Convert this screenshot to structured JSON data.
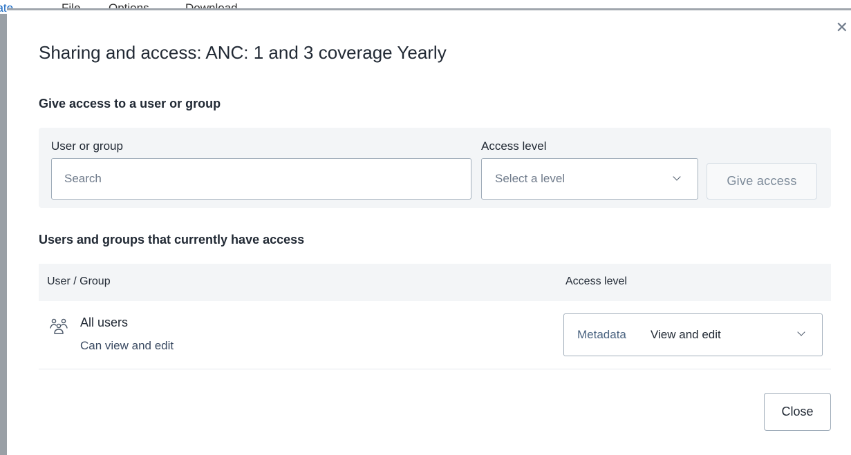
{
  "background_menu": {
    "first_item": "date",
    "file": "File",
    "options": "Options",
    "download": "Download"
  },
  "modal": {
    "title": "Sharing and access: ANC: 1 and 3 coverage Yearly",
    "close_icon": "close-icon",
    "give_access": {
      "heading": "Give access to a user or group",
      "user_label": "User or group",
      "search_placeholder": "Search",
      "level_label": "Access level",
      "level_placeholder": "Select a level",
      "give_button": "Give access"
    },
    "current_access": {
      "heading": "Users and groups that currently have access",
      "columns": [
        "User / Group",
        "Access level"
      ],
      "rows": [
        {
          "icon": "users-group-icon",
          "name": "All users",
          "description": "Can view and edit",
          "access_prefix": "Metadata",
          "access_value": "View and edit"
        }
      ]
    },
    "close_button": "Close"
  }
}
